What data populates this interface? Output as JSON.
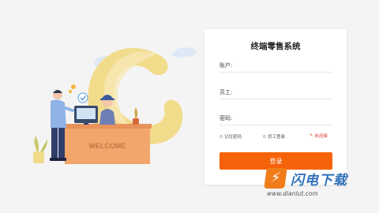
{
  "illustration": {
    "desk_sign": "WELCOME"
  },
  "login": {
    "title": "终端零售系统",
    "account_label": "账户:",
    "account_value": "",
    "staff_label": "员工:",
    "staff_value": "",
    "password_label": "密码:",
    "password_value": "",
    "remember_label": "记住密码",
    "staff_login_label": "员工登录",
    "connection_status": "未连接",
    "submit_label": "登录"
  },
  "watermark": {
    "name": "闪电下载",
    "url": "www.dianlut.com"
  },
  "colors": {
    "accent": "#f5620a",
    "status": "#e03a2f",
    "brand_blue": "#2f6fb8"
  }
}
